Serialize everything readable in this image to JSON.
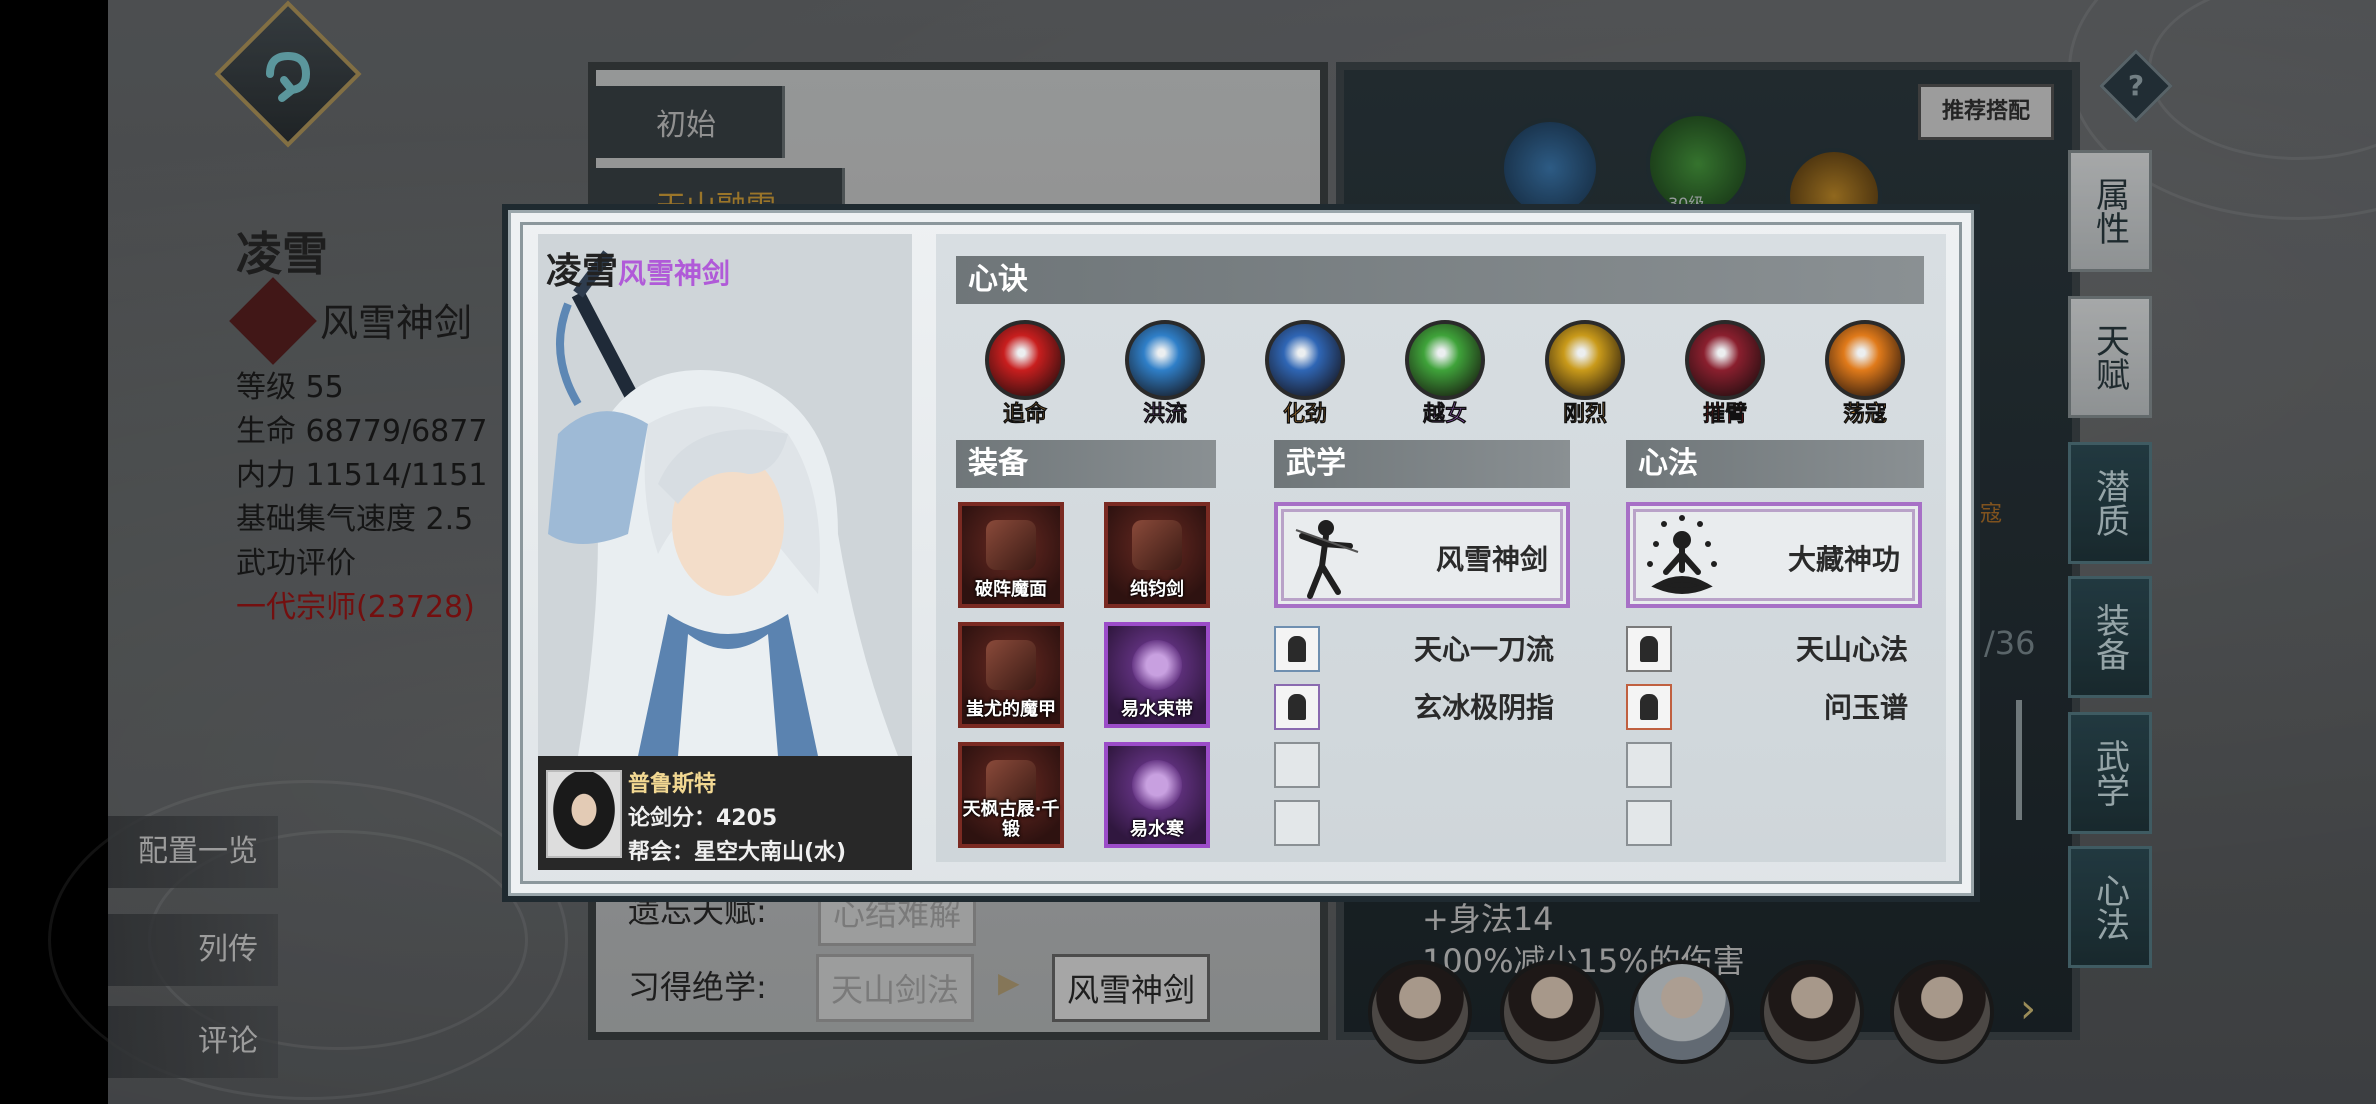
{
  "background": {
    "character_name": "凌雪",
    "character_title": "风雪神剑",
    "stats": [
      "等级 55",
      "生命 68779/6877",
      "内力 11514/1151",
      "基础集气速度 2.5",
      "武功评价"
    ],
    "rating": "一代宗师(23728)",
    "side_buttons": [
      "配置一览",
      "列传",
      "评论"
    ],
    "center_tabs": [
      "初始",
      "天山融雪"
    ],
    "talent_row_label": "遗忘天赋:",
    "talent_value": "心结难解",
    "skills_row_label": "习得绝学:",
    "skill_from": "天山剑法",
    "skill_to": "风雪神剑",
    "recommend_button": "推荐搭配",
    "help_label": "?",
    "right_texts": [
      "+身法14",
      "100%减少15%的伤害"
    ],
    "counter": "/36",
    "orb_label": "30级",
    "orb_side_label": "寇",
    "vertical_tabs": [
      "属性",
      "天赋",
      "潜质",
      "装备",
      "武学",
      "心法"
    ]
  },
  "modal": {
    "character_name": "凌雪",
    "character_title": "风雪神剑",
    "player": {
      "name": "普鲁斯特",
      "score": "论剑分：4205",
      "guild": "帮会：星空大南山(水)"
    },
    "xinjue": {
      "header": "心诀",
      "items": [
        {
          "name": "追命",
          "color": "#c81e1e",
          "label_color": "#f2a33a"
        },
        {
          "name": "洪流",
          "color": "#2f7fc8",
          "label_color": "#b46ae0"
        },
        {
          "name": "化劲",
          "color": "#2f66b5",
          "label_color": "#f2a33a"
        },
        {
          "name": "越女",
          "color": "#3fa33a",
          "label_color": "#b46ae0"
        },
        {
          "name": "刚烈",
          "color": "#c99a1a",
          "label_color": "#f2a33a"
        },
        {
          "name": "摧臂",
          "color": "#8a1f2e",
          "label_color": "#d81a1a"
        },
        {
          "name": "荡寇",
          "color": "#e07a1a",
          "label_color": "#f2a33a"
        }
      ]
    },
    "equipment": {
      "header": "装备",
      "items": [
        {
          "name": "破阵魔面",
          "rarity": "red"
        },
        {
          "name": "纯钧剑",
          "rarity": "red"
        },
        {
          "name": "蚩尤的魔甲",
          "rarity": "red"
        },
        {
          "name": "易水束带",
          "rarity": "purple"
        },
        {
          "name": "天枫古屐·千锻",
          "rarity": "red"
        },
        {
          "name": "易水寒",
          "rarity": "purple"
        }
      ]
    },
    "martial": {
      "header": "武学",
      "main": "风雪神剑",
      "subs": [
        "天心一刀流",
        "玄冰极阴指"
      ]
    },
    "heart": {
      "header": "心法",
      "main": "大藏神功",
      "subs": [
        "天山心法",
        "问玉谱"
      ]
    }
  }
}
